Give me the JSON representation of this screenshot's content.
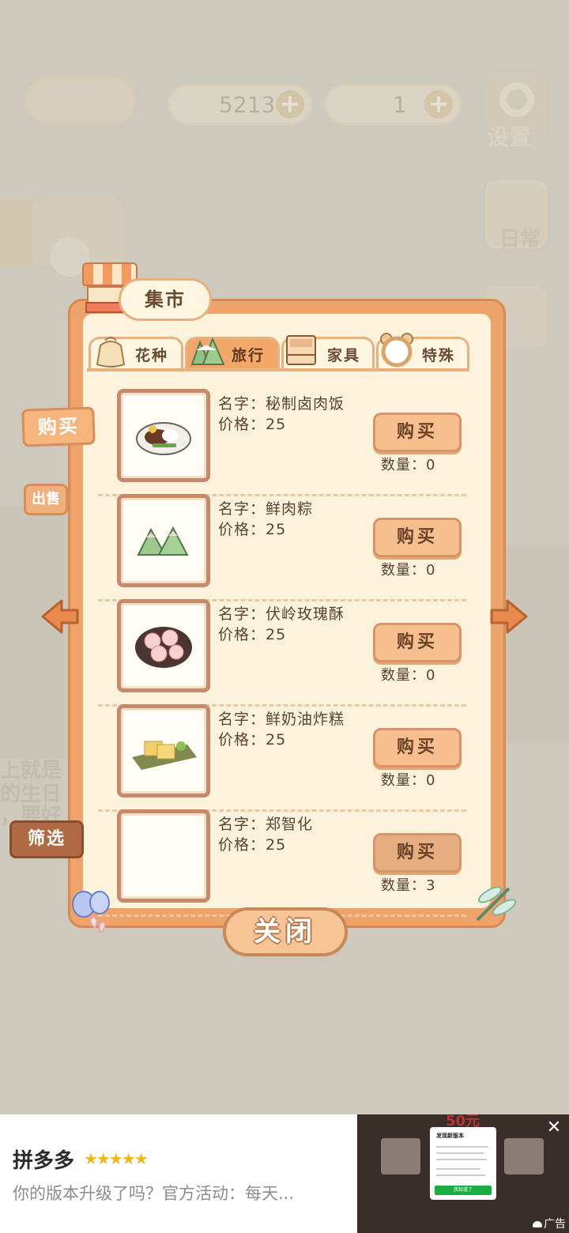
{
  "hud": {
    "fish_count": "5213",
    "cheese_count": "1",
    "settings_label": "设置",
    "daily_label": "日常"
  },
  "background_text": {
    "line1": "上就是",
    "line2": "的生日",
    "line3": "，要好"
  },
  "market": {
    "title": "集市",
    "tabs": [
      {
        "label": "花种",
        "active": false
      },
      {
        "label": "旅行",
        "active": true
      },
      {
        "label": "家具",
        "active": false
      },
      {
        "label": "特殊",
        "active": false
      }
    ],
    "items": [
      {
        "name": "名字：秘制卤肉饭",
        "price": "价格：25",
        "button": "购买",
        "quantity": "数量：0"
      },
      {
        "name": "名字：鲜肉粽",
        "price": "价格：25",
        "button": "购买",
        "quantity": "数量：0"
      },
      {
        "name": "名字：伏岭玫瑰酥",
        "price": "价格：25",
        "button": "购买",
        "quantity": "数量：0"
      },
      {
        "name": "名字：鲜奶油炸糕",
        "price": "价格：25",
        "button": "购买",
        "quantity": "数量：0"
      },
      {
        "name": "名字：郑智化",
        "price": "价格：25",
        "button": "购买",
        "quantity": "数量：3"
      }
    ],
    "side_buttons": {
      "buy": "购买",
      "sell": "出售",
      "filter": "筛选"
    },
    "close_label": "关闭"
  },
  "ad": {
    "title": "拼多多",
    "stars": "★★★★★",
    "description": "你的版本升级了吗？官方活动：每天...",
    "label": "广告",
    "popup_title": "发现新版本",
    "popup_button": "我知道了",
    "banner_price": "50元"
  },
  "colors": {
    "panel_orange": "#eea36b",
    "panel_cream": "#fdf3dc",
    "text_brown": "#5b4232",
    "button_peach": "#f7bf8e"
  }
}
